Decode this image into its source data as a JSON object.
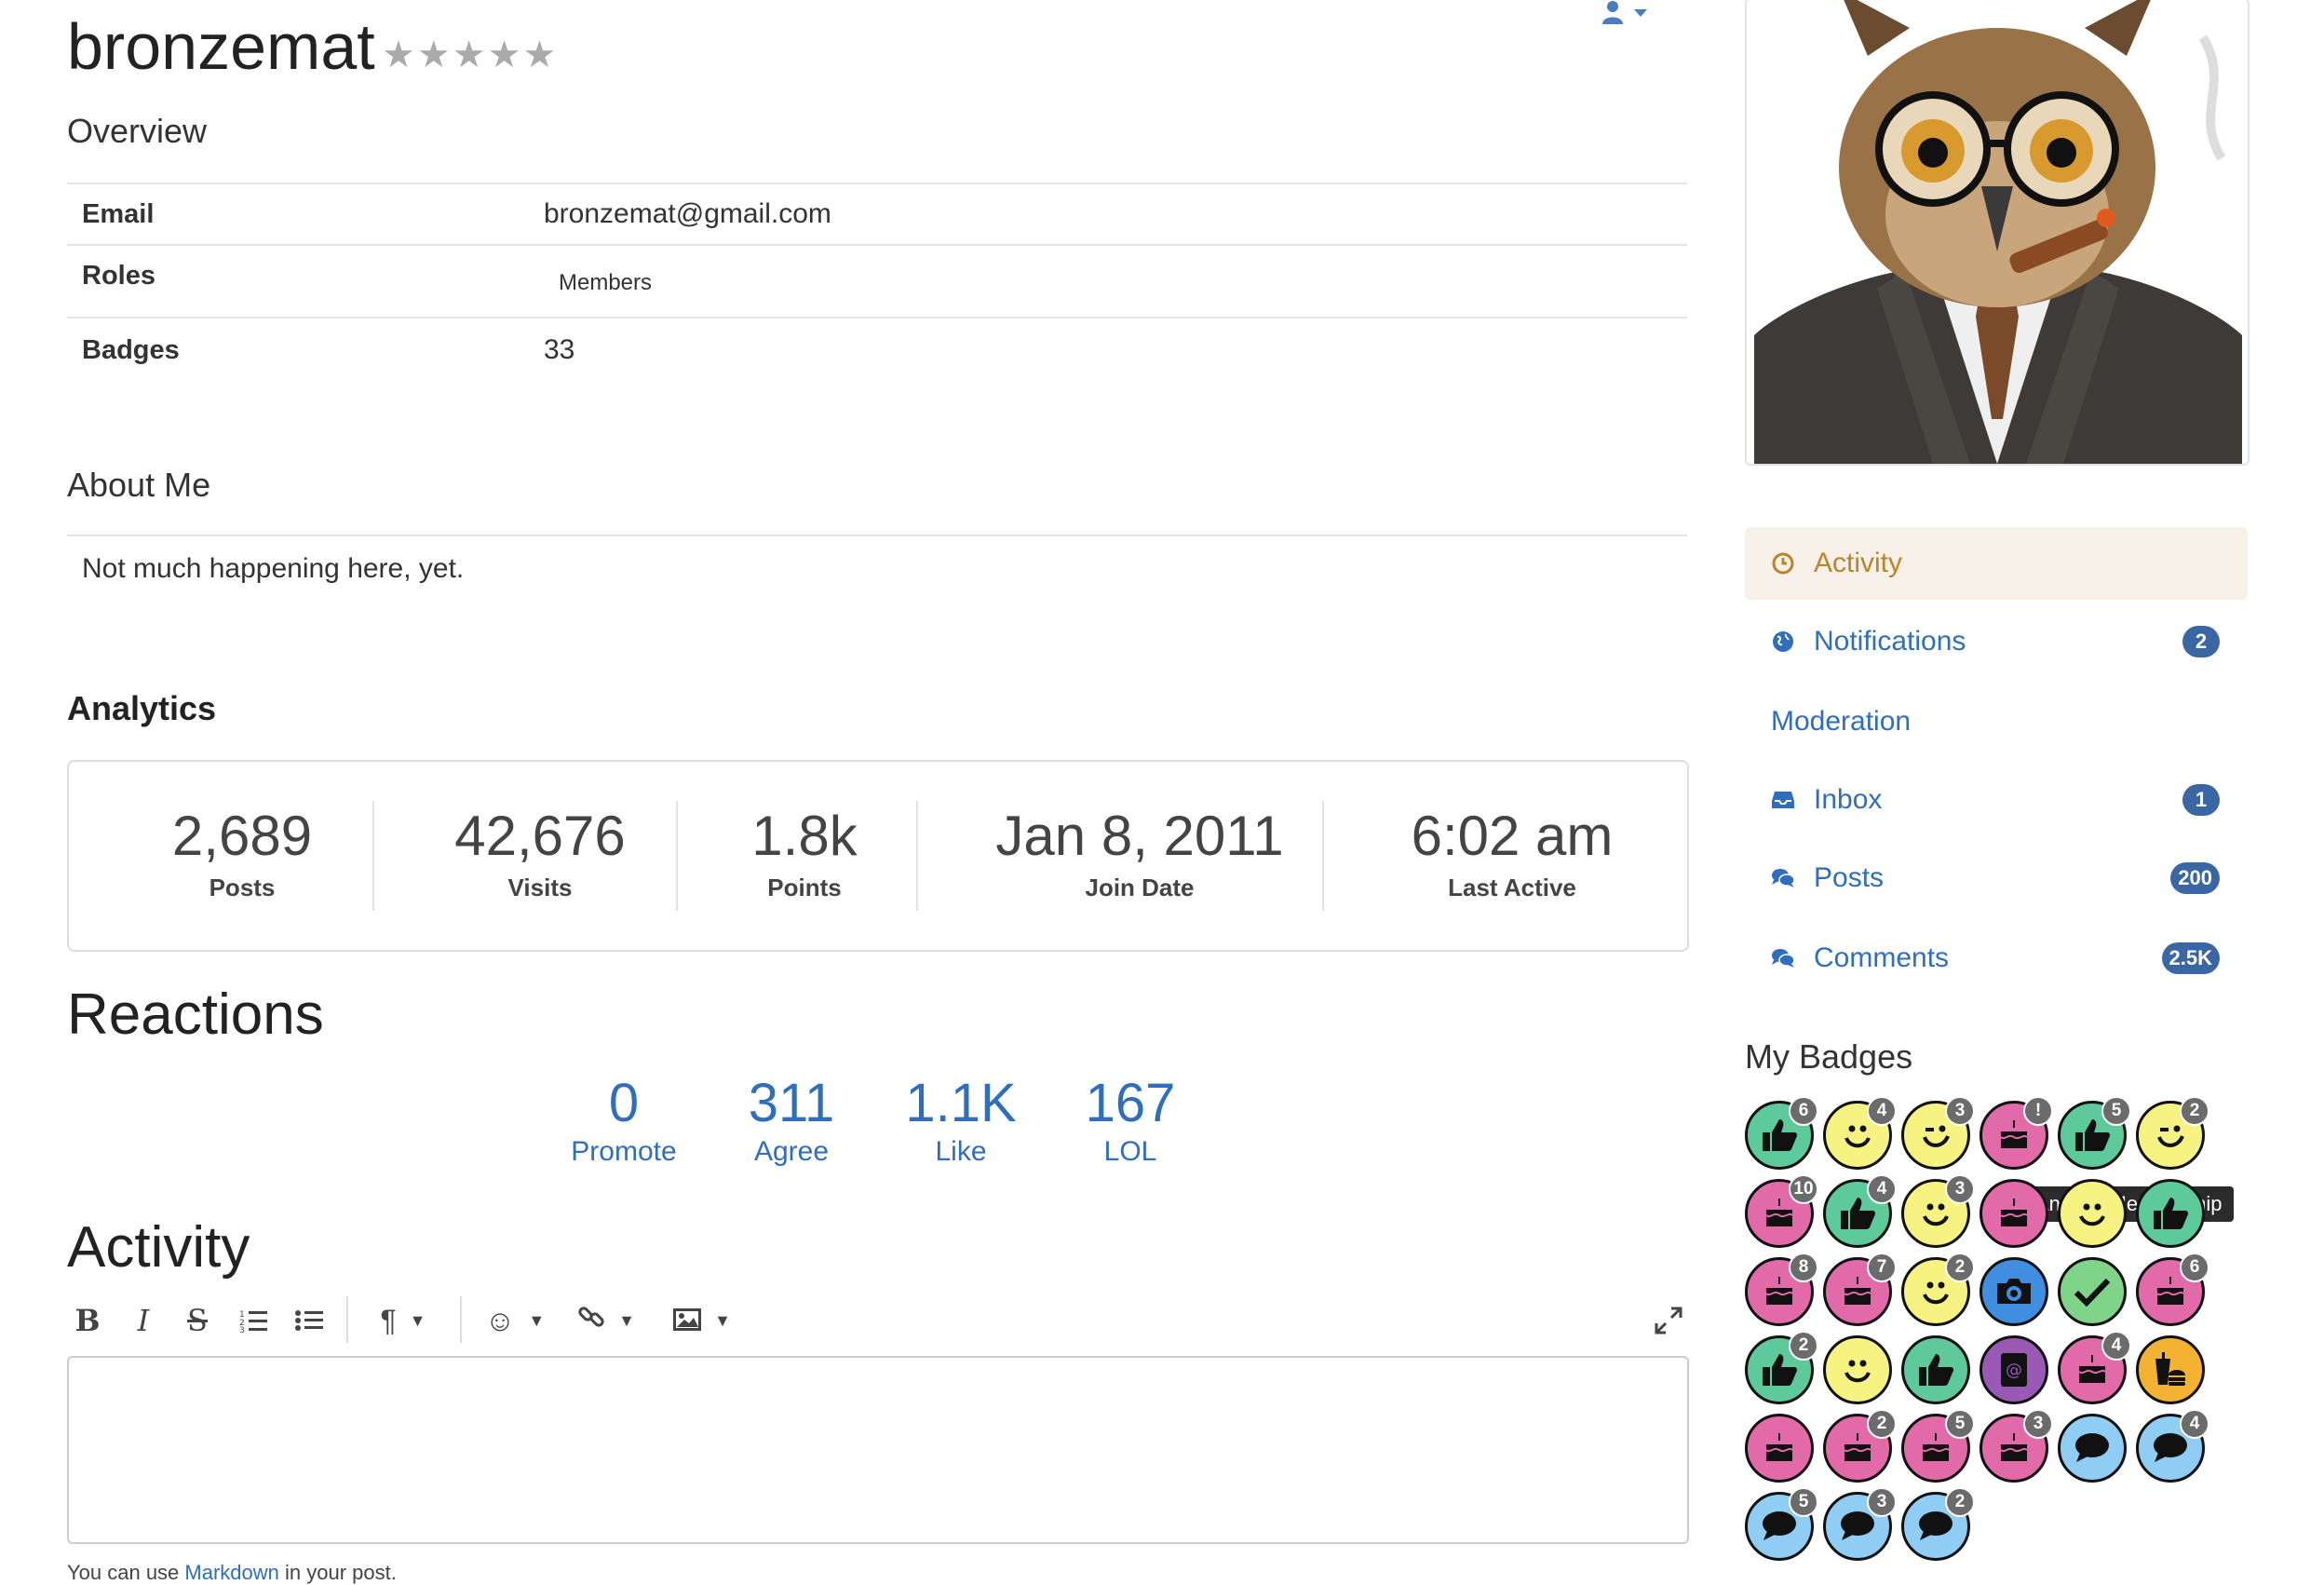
{
  "profile": {
    "username": "bronzemat",
    "stars": "★★★★★"
  },
  "overview": {
    "title": "Overview",
    "rows": [
      {
        "label": "Email",
        "value": "bronzemat@gmail.com"
      },
      {
        "label": "Roles",
        "value": "Members"
      },
      {
        "label": "Badges",
        "value": "33"
      }
    ]
  },
  "about": {
    "title": "About Me",
    "text": "Not much happening here, yet."
  },
  "analytics": {
    "title": "Analytics",
    "stats": [
      {
        "value": "2,689",
        "label": "Posts"
      },
      {
        "value": "42,676",
        "label": "Visits"
      },
      {
        "value": "1.8k",
        "label": "Points"
      },
      {
        "value": "Jan 8, 2011",
        "label": "Join Date"
      },
      {
        "value": "6:02 am",
        "label": "Last Active"
      }
    ]
  },
  "reactions": {
    "title": "Reactions",
    "items": [
      {
        "value": "0",
        "label": "Promote"
      },
      {
        "value": "311",
        "label": "Agree"
      },
      {
        "value": "1.1K",
        "label": "Like"
      },
      {
        "value": "167",
        "label": "LOL"
      }
    ]
  },
  "activity": {
    "title": "Activity",
    "toolbar": [
      "bold-icon",
      "italic-icon",
      "strikethrough-icon",
      "ordered-list-icon",
      "bullet-list-icon",
      "paragraph-icon",
      "emoji-icon",
      "link-icon",
      "image-icon",
      "fullscreen-icon"
    ],
    "note_prefix": "You can use ",
    "note_link": "Markdown",
    "note_suffix": " in your post."
  },
  "sidebar": {
    "nav": [
      {
        "label": "Activity",
        "icon": "clock-icon",
        "count": ""
      },
      {
        "label": "Notifications",
        "icon": "globe-icon",
        "count": "2"
      },
      {
        "label": "Moderation",
        "icon": "",
        "count": ""
      },
      {
        "label": "Inbox",
        "icon": "inbox-icon",
        "count": "1"
      },
      {
        "label": "Posts",
        "icon": "comments-icon",
        "count": "200"
      },
      {
        "label": "Comments",
        "icon": "comments-icon",
        "count": "2.5K"
      }
    ],
    "badges_title": "My Badges",
    "tooltip": "Ancient Membership",
    "badges": [
      {
        "type": "thumb",
        "color": "#5ec99a",
        "count": "6"
      },
      {
        "type": "smile",
        "color": "#f7f383",
        "count": "4"
      },
      {
        "type": "wink",
        "color": "#f7f383",
        "count": "3"
      },
      {
        "type": "cake",
        "color": "#e26aa8",
        "count": "!"
      },
      {
        "type": "thumb",
        "color": "#5ec99a",
        "count": "5"
      },
      {
        "type": "wink",
        "color": "#f7f383",
        "count": "2"
      },
      {
        "type": "cake",
        "color": "#e26aa8",
        "count": "10"
      },
      {
        "type": "thumb",
        "color": "#5ec99a",
        "count": "4"
      },
      {
        "type": "smile",
        "color": "#f7f383",
        "count": "3"
      },
      {
        "type": "cake",
        "color": "#e26aa8",
        "count": ""
      },
      {
        "type": "smile",
        "color": "#f7f383",
        "count": ""
      },
      {
        "type": "thumb",
        "color": "#5ec99a",
        "count": ""
      },
      {
        "type": "cake",
        "color": "#e26aa8",
        "count": "8"
      },
      {
        "type": "cake",
        "color": "#e26aa8",
        "count": "7"
      },
      {
        "type": "smile",
        "color": "#f7f383",
        "count": "2"
      },
      {
        "type": "camera",
        "color": "#3f8ee0",
        "count": ""
      },
      {
        "type": "check",
        "color": "#7fd48a",
        "count": ""
      },
      {
        "type": "cake",
        "color": "#e26aa8",
        "count": "6"
      },
      {
        "type": "thumb",
        "color": "#5ec99a",
        "count": "2"
      },
      {
        "type": "smile",
        "color": "#f7f383",
        "count": ""
      },
      {
        "type": "thumb",
        "color": "#5ec99a",
        "count": ""
      },
      {
        "type": "address",
        "color": "#9b59b6",
        "count": ""
      },
      {
        "type": "cake",
        "color": "#e26aa8",
        "count": "4"
      },
      {
        "type": "food",
        "color": "#f4b233",
        "count": ""
      },
      {
        "type": "cake",
        "color": "#e26aa8",
        "count": ""
      },
      {
        "type": "cake",
        "color": "#e26aa8",
        "count": "2"
      },
      {
        "type": "cake",
        "color": "#e26aa8",
        "count": "5"
      },
      {
        "type": "cake",
        "color": "#e26aa8",
        "count": "3"
      },
      {
        "type": "chat",
        "color": "#8fcdf5",
        "count": ""
      },
      {
        "type": "chat",
        "color": "#8fcdf5",
        "count": "4"
      },
      {
        "type": "chat",
        "color": "#8fcdf5",
        "count": "5"
      },
      {
        "type": "chat",
        "color": "#8fcdf5",
        "count": "3"
      },
      {
        "type": "chat",
        "color": "#8fcdf5",
        "count": "2"
      }
    ]
  }
}
